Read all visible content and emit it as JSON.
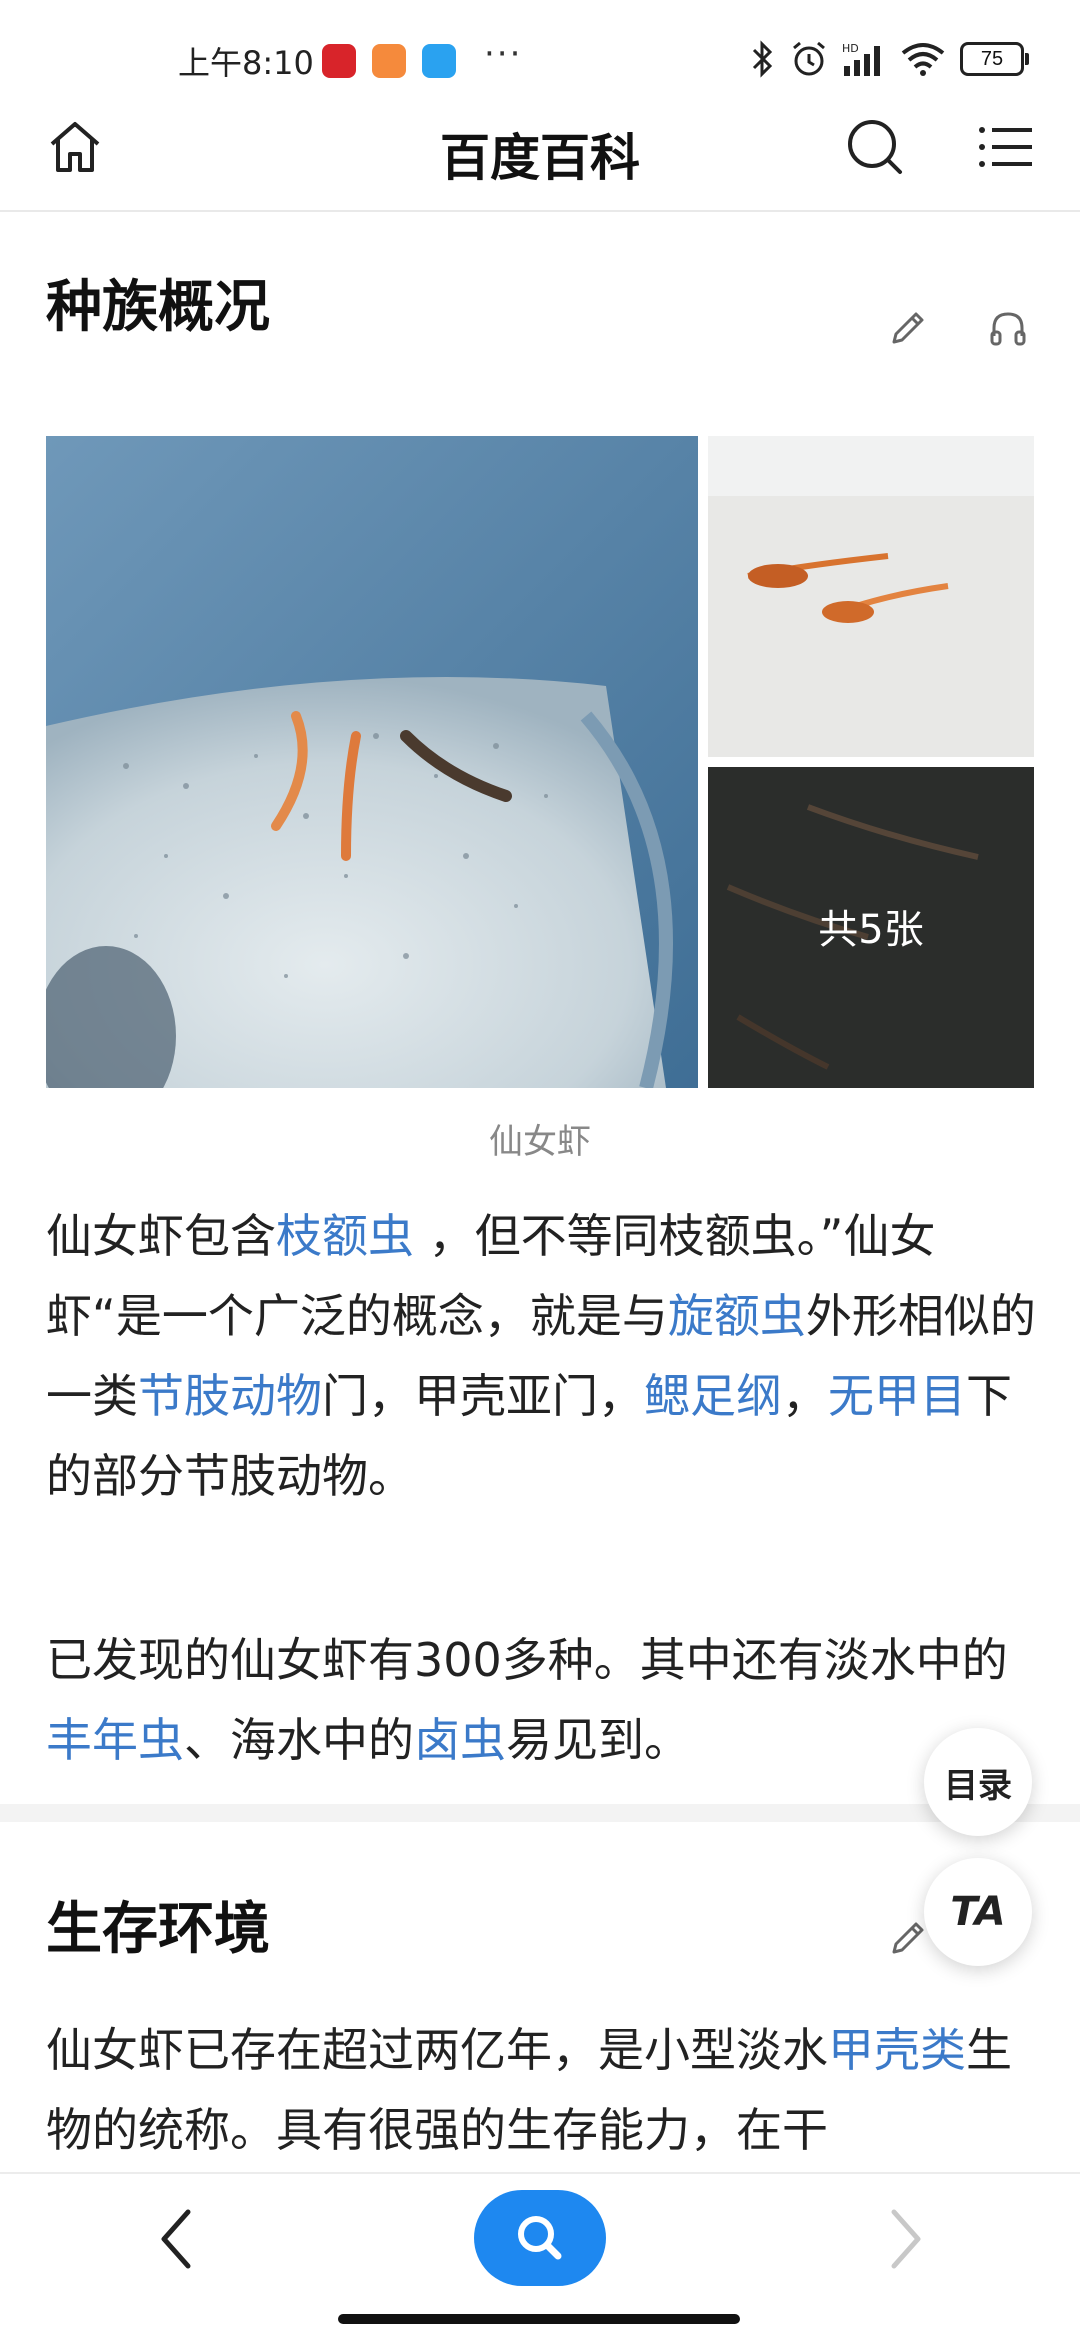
{
  "status_bar": {
    "time": "上午8:10",
    "dots": "···",
    "battery": "75",
    "network": "HD"
  },
  "header": {
    "title": "百度百科",
    "icons": [
      "home-icon",
      "search-icon",
      "menu-icon"
    ]
  },
  "section1": {
    "title": "种族概况",
    "gallery": {
      "count_label": "共5张",
      "caption": "仙女虾"
    },
    "para1": {
      "t1": "仙女虾包含",
      "l1": "枝额虫",
      "t2": " ，但不等同枝额虫。”仙女虾“是一个广泛的概念，就是与",
      "l2": "旋额虫",
      "t3": "外形相似的一类",
      "l3": "节肢动物",
      "t4": "门，甲壳亚门，",
      "l4": "鳃足纲",
      "t5": "，",
      "l5": "无甲目",
      "t6": "下的部分节肢动物。"
    },
    "para2": {
      "t1": "已发现的仙女虾有300多种。其中还有淡水中的",
      "l1": "丰年虫",
      "t2": "、海水中的",
      "l2": "卤虫",
      "t3": "易见到。"
    }
  },
  "section2": {
    "title": "生存环境",
    "para1": {
      "t1": "仙女虾已存在超过两亿年，是小型淡水",
      "l1": "甲壳类",
      "t2": "生物的统称。具有很强的生存能力，在干"
    }
  },
  "floating": {
    "toc_label": "目录",
    "ta_label": "TA"
  },
  "colors": {
    "link": "#3b7ac9",
    "accent": "#1e88f0"
  }
}
